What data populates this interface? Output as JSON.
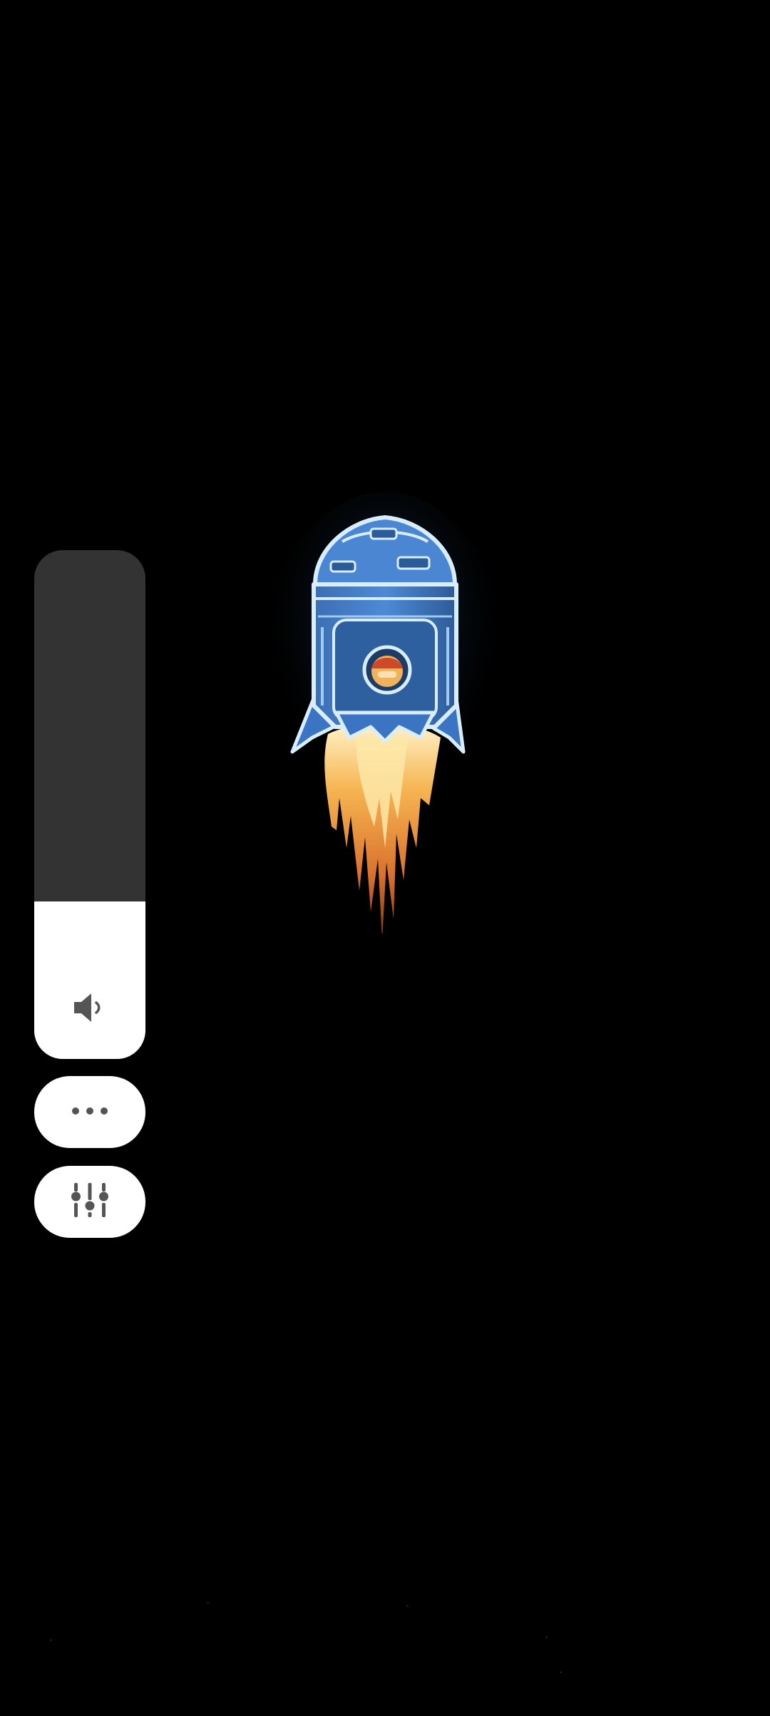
{
  "volume_dialog": {
    "level": 0.31,
    "speaker_icon": "speaker-icon",
    "more_icon": "more-horizontal-icon",
    "settings_icon": "equalizer-sliders-icon"
  },
  "wallpaper": {
    "subject": "rocket-illustration"
  },
  "colors": {
    "background": "#000000",
    "panel_track": "#333333",
    "panel_fill": "#ffffff",
    "icon": "#555555",
    "rocket_body": "#3f7fcf",
    "rocket_outline": "#cfe8ff",
    "flame": "#f0a43a"
  }
}
